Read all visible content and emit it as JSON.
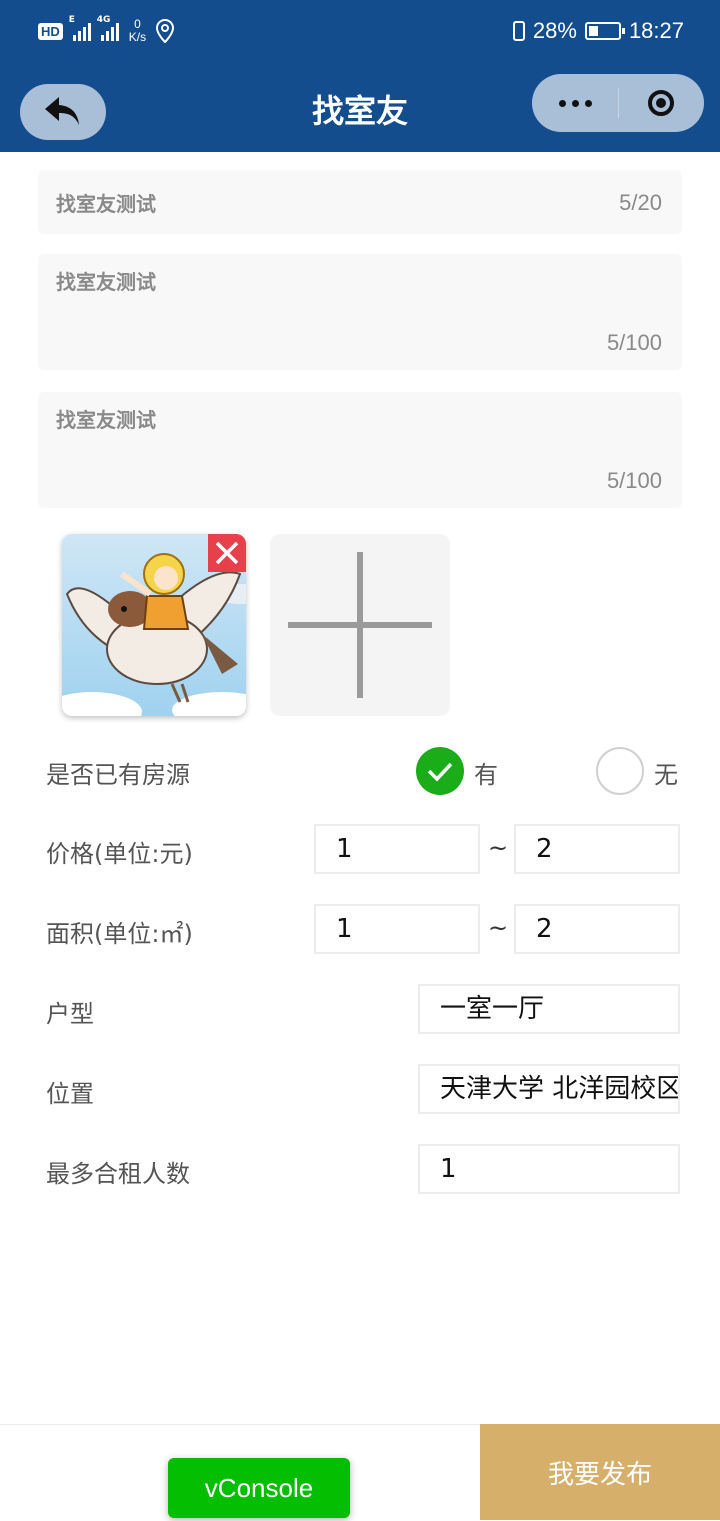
{
  "status_bar": {
    "hd_label": "HD",
    "net1_label": "E",
    "net2_label": "4G",
    "speed_value": "0",
    "speed_unit": "K/s",
    "battery_percent": "28%",
    "time": "18:27"
  },
  "navbar": {
    "title": "找室友"
  },
  "form": {
    "title": {
      "value": "找室友测试",
      "counter": "5/20"
    },
    "desc1": {
      "value": "找室友测试",
      "counter": "5/100"
    },
    "desc2": {
      "value": "找室友测试",
      "counter": "5/100"
    },
    "images_count": 1
  },
  "has_house": {
    "label": "是否已有房源",
    "option_yes": "有",
    "option_no": "无",
    "selected": "有"
  },
  "price": {
    "label": "价格(单位:元)",
    "min": "1",
    "separator": "~",
    "max": "2"
  },
  "area": {
    "label": "面积(单位:㎡)",
    "min": "1",
    "separator": "~",
    "max": "2"
  },
  "layout": {
    "label": "户型",
    "value": "一室一厅"
  },
  "location": {
    "label": "位置",
    "value": "天津大学 北洋园校区"
  },
  "max_people": {
    "label": "最多合租人数",
    "value": "1"
  },
  "footer": {
    "vconsole": "vConsole",
    "publish": "我要发布"
  },
  "colors": {
    "header": "#134d8e",
    "accent_green": "#1aad19",
    "publish": "#d6b06a",
    "delete_red": "#e8404a"
  }
}
